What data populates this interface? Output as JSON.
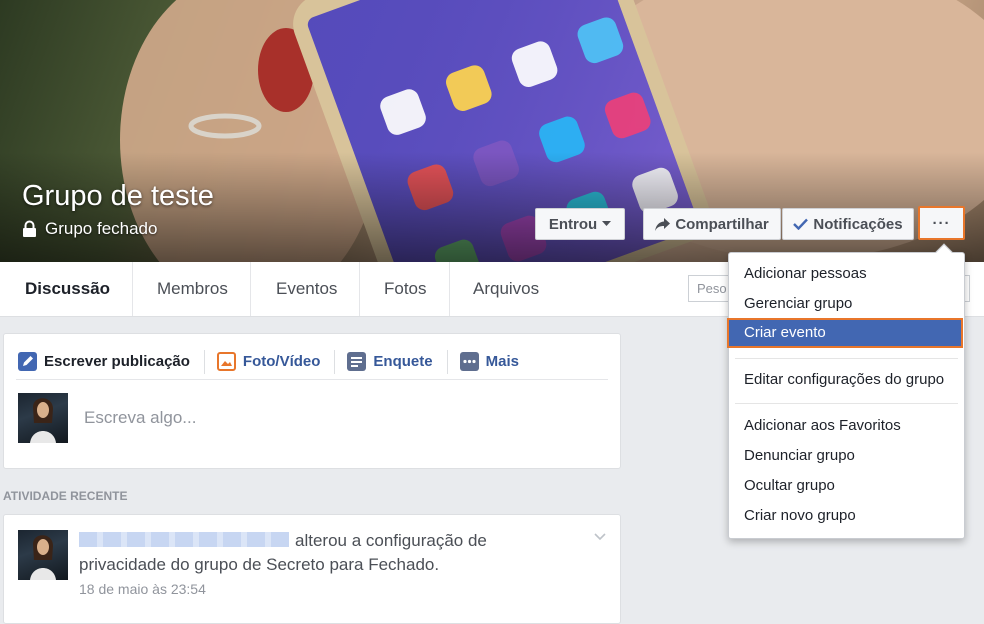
{
  "cover": {
    "group_name": "Grupo de teste",
    "privacy": "Grupo fechado",
    "buttons": {
      "joined": "Entrou",
      "share": "Compartilhar",
      "notifications": "Notificações",
      "more": "···"
    }
  },
  "tabs": [
    "Discussão",
    "Membros",
    "Eventos",
    "Fotos",
    "Arquivos"
  ],
  "search": {
    "placeholder": "Peso"
  },
  "composer": {
    "actions": [
      "Escrever publicação",
      "Foto/Vídeo",
      "Enquete",
      "Mais"
    ],
    "placeholder": "Escreva algo..."
  },
  "recent": {
    "label": "ATIVIDADE RECENTE",
    "text": "alterou a configuração de privacidade do grupo de Secreto para Fechado.",
    "time": "18 de maio às 23:54"
  },
  "menu": {
    "items": [
      "Adicionar pessoas",
      "Gerenciar grupo",
      "Criar evento",
      "Editar configurações do grupo",
      "Adicionar aos Favoritos",
      "Denunciar grupo",
      "Ocultar grupo",
      "Criar novo grupo"
    ]
  },
  "colors": {
    "facebook_blue": "#4267b2",
    "link_blue": "#365899",
    "highlight_border": "#e8762b"
  }
}
